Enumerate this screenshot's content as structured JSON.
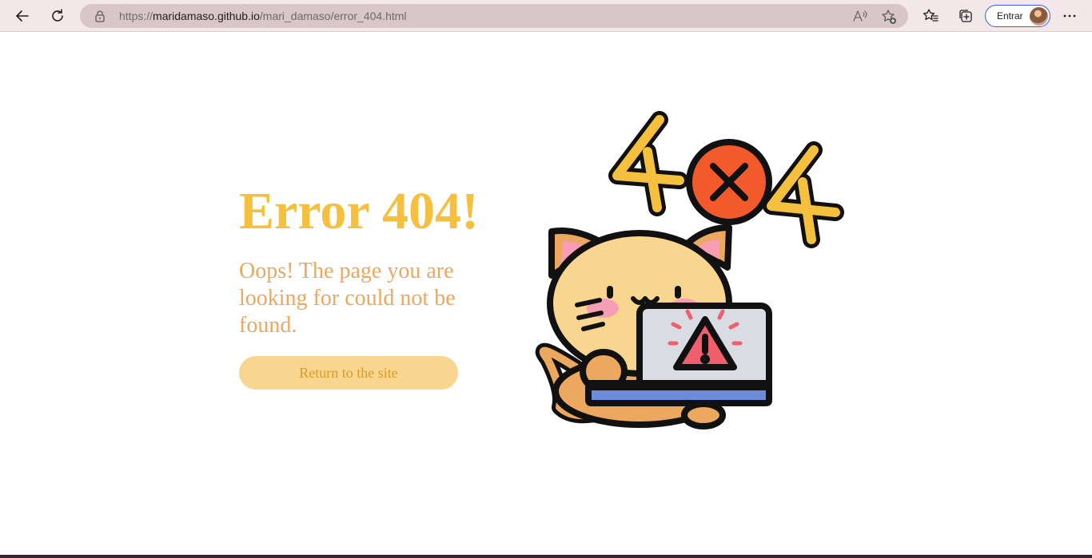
{
  "browser": {
    "url_scheme": "https://",
    "url_host": "maridamaso.github.io",
    "url_path": "/mari_damaso/error_404.html",
    "signin_label": "Entrar",
    "icons": [
      "back-icon",
      "refresh-icon",
      "lock-icon",
      "read-aloud-icon",
      "add-favorite-icon",
      "favorites-icon",
      "collections-icon",
      "more-icon"
    ]
  },
  "page": {
    "title": "Error 404!",
    "message": "Oops! The page you are looking for could not be found.",
    "return_button": "Return to the site"
  },
  "colors": {
    "title": "#f6c03f",
    "message": "#eba85e",
    "button_bg": "#f9d68f",
    "button_text": "#d99a2c"
  }
}
